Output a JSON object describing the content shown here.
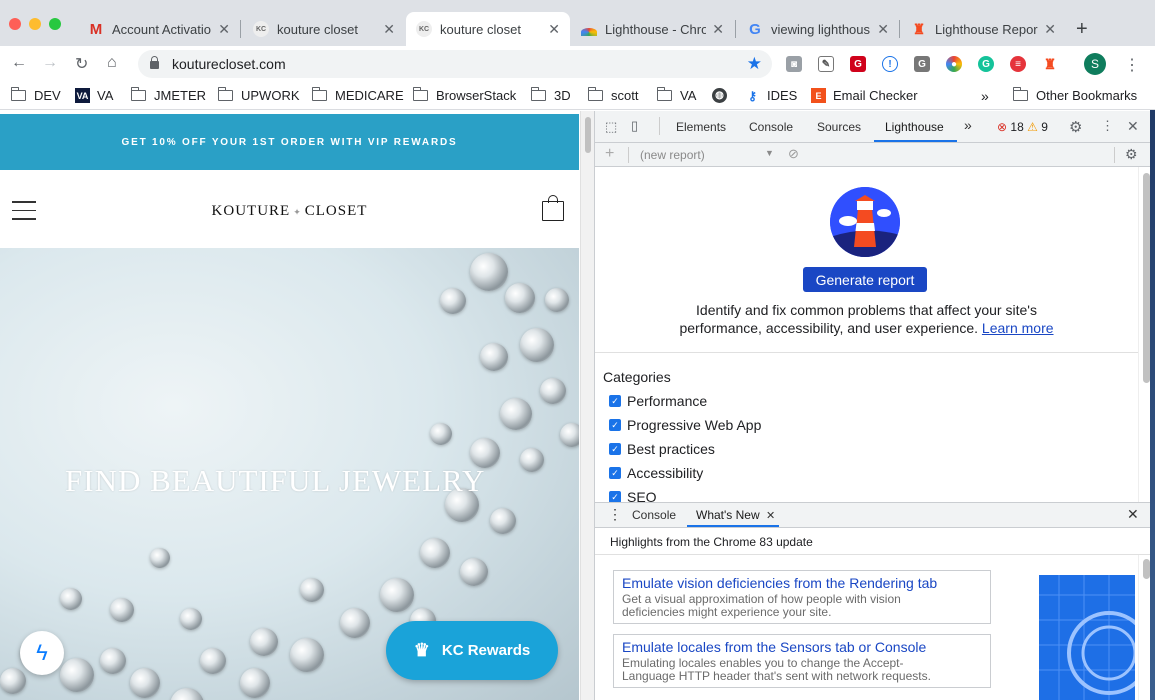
{
  "browser": {
    "tabs": [
      {
        "title": "Account Activatio",
        "icon": "gmail-icon"
      },
      {
        "title": "kouture closet",
        "icon": "kc-favicon"
      },
      {
        "title": "kouture closet",
        "icon": "kc-favicon",
        "active": true
      },
      {
        "title": "Lighthouse - Chro",
        "icon": "lighthouse-rainbow-icon"
      },
      {
        "title": "viewing lighthous",
        "icon": "google-icon"
      },
      {
        "title": "Lighthouse Repor",
        "icon": "lighthouse-icon"
      }
    ],
    "url": "kouturecloset.com",
    "profile_initial": "S",
    "bookmarks": [
      {
        "label": "DEV",
        "icon": "folder-icon"
      },
      {
        "label": "VA",
        "icon": "va-icon"
      },
      {
        "label": "JMETER",
        "icon": "folder-icon"
      },
      {
        "label": "UPWORK",
        "icon": "folder-icon"
      },
      {
        "label": "MEDICARE",
        "icon": "folder-icon"
      },
      {
        "label": "BrowserStack",
        "icon": "folder-icon"
      },
      {
        "label": "3D",
        "icon": "folder-icon"
      },
      {
        "label": "scott",
        "icon": "folder-icon"
      },
      {
        "label": "VA",
        "icon": "folder-icon"
      },
      {
        "label": "",
        "icon": "globe-icon"
      },
      {
        "label": "IDES",
        "icon": "key-icon"
      },
      {
        "label": "Email Checker",
        "icon": "e-icon"
      }
    ],
    "bookmarks_overflow": "»",
    "other_bookmarks": "Other Bookmarks"
  },
  "site": {
    "promo": "GET 10% OFF YOUR 1ST ORDER WITH VIP REWARDS",
    "logo_left": "KOUTURE",
    "logo_sep": "✦",
    "logo_right": "CLOSET",
    "hero_text": "FIND BEAUTIFUL JEWELRY",
    "rewards_label": "KC Rewards"
  },
  "devtools": {
    "tabs": [
      "Elements",
      "Console",
      "Sources",
      "Lighthouse"
    ],
    "active_tab": "Lighthouse",
    "more": "»",
    "errors": "18",
    "warnings": "9",
    "report_select": "(new report)",
    "generate_label": "Generate report",
    "description_line1": "Identify and fix common problems that affect your site's",
    "description_line2": "performance, accessibility, and user experience.",
    "learn_more": "Learn more",
    "categories_title": "Categories",
    "categories": [
      "Performance",
      "Progressive Web App",
      "Best practices",
      "Accessibility",
      "SEO"
    ],
    "drawer_tabs": [
      "Console",
      "What's New"
    ],
    "highlights": "Highlights from the Chrome 83 update",
    "whats_new": [
      {
        "title": "Emulate vision deficiencies from the Rendering tab",
        "desc1": "Get a visual approximation of how people with vision",
        "desc2": "deficiencies might experience your site."
      },
      {
        "title": "Emulate locales from the Sensors tab or Console",
        "desc1": "Emulating locales enables you to change the Accept-",
        "desc2": "Language HTTP header that's sent with network requests."
      }
    ]
  },
  "colors": {
    "promo_bar": "#2aa0c6",
    "rewards": "#1aa3d9",
    "generate_button": "#1a47c4",
    "lighthouse_logo": "#304ffe"
  }
}
